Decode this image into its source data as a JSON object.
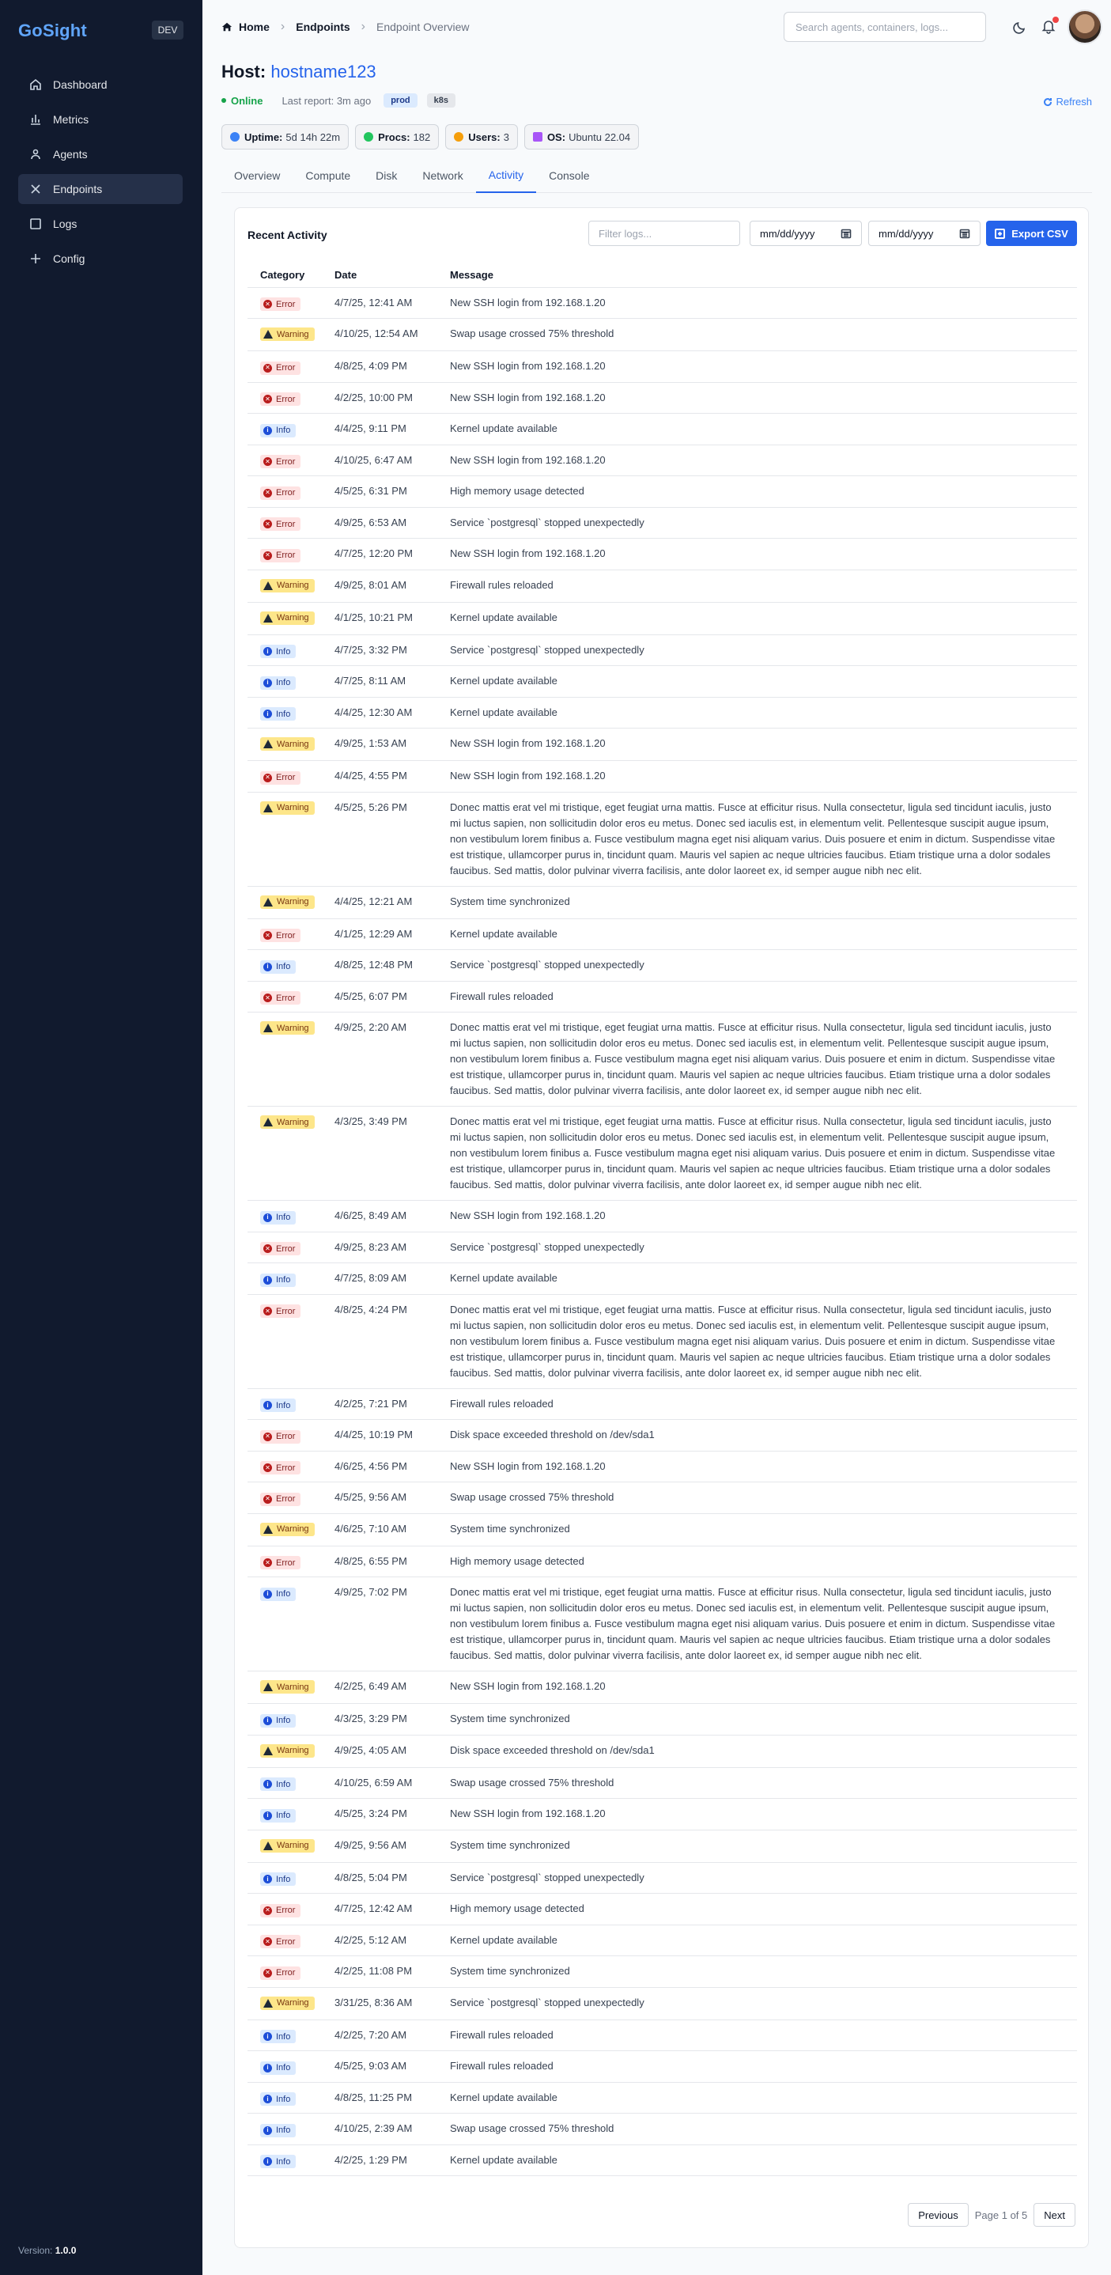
{
  "brand": {
    "name": "GoSight",
    "env": "DEV"
  },
  "sidebar": {
    "items": [
      {
        "label": "Dashboard",
        "icon": "home-icon",
        "active": false
      },
      {
        "label": "Metrics",
        "icon": "bar-chart-icon",
        "active": false
      },
      {
        "label": "Agents",
        "icon": "user-icon",
        "active": false
      },
      {
        "label": "Endpoints",
        "icon": "x-icon",
        "active": true
      },
      {
        "label": "Logs",
        "icon": "square-icon",
        "active": false
      },
      {
        "label": "Config",
        "icon": "plus-icon",
        "active": false
      }
    ],
    "version_label": "Version:",
    "version": "1.0.0"
  },
  "header": {
    "breadcrumb": [
      "Home",
      "Endpoints",
      "Endpoint Overview"
    ],
    "search_placeholder": "Search agents, containers, logs..."
  },
  "host": {
    "label": "Host:",
    "name": "hostname123",
    "status": "Online",
    "last_report": "Last report: 3m ago",
    "tags": [
      "prod",
      "k8s"
    ],
    "refresh": "Refresh"
  },
  "stats": [
    {
      "label": "Uptime:",
      "value": "5d 14h 22m",
      "color": "#3b82f6"
    },
    {
      "label": "Procs:",
      "value": "182",
      "color": "#22c55e"
    },
    {
      "label": "Users:",
      "value": "3",
      "color": "#f59e0b"
    },
    {
      "label": "OS:",
      "value": "Ubuntu 22.04",
      "color": "#a855f7"
    }
  ],
  "tabs": [
    "Overview",
    "Compute",
    "Disk",
    "Network",
    "Activity",
    "Console"
  ],
  "active_tab": "Activity",
  "activity": {
    "title": "Recent Activity",
    "filter_placeholder": "Filter logs...",
    "date_placeholder": "mm/dd/yyyy",
    "export_label": "Export CSV",
    "columns": [
      "Category",
      "Date",
      "Message"
    ],
    "rows": [
      {
        "cat": "Error",
        "date": "4/7/25, 12:41 AM",
        "msg": "New SSH login from 192.168.1.20"
      },
      {
        "cat": "Warning",
        "date": "4/10/25, 12:54 AM",
        "msg": "Swap usage crossed 75% threshold"
      },
      {
        "cat": "Error",
        "date": "4/8/25, 4:09 PM",
        "msg": "New SSH login from 192.168.1.20"
      },
      {
        "cat": "Error",
        "date": "4/2/25, 10:00 PM",
        "msg": "New SSH login from 192.168.1.20"
      },
      {
        "cat": "Info",
        "date": "4/4/25, 9:11 PM",
        "msg": "Kernel update available"
      },
      {
        "cat": "Error",
        "date": "4/10/25, 6:47 AM",
        "msg": "New SSH login from 192.168.1.20"
      },
      {
        "cat": "Error",
        "date": "4/5/25, 6:31 PM",
        "msg": "High memory usage detected"
      },
      {
        "cat": "Error",
        "date": "4/9/25, 6:53 AM",
        "msg": "Service `postgresql` stopped unexpectedly"
      },
      {
        "cat": "Error",
        "date": "4/7/25, 12:20 PM",
        "msg": "New SSH login from 192.168.1.20"
      },
      {
        "cat": "Warning",
        "date": "4/9/25, 8:01 AM",
        "msg": "Firewall rules reloaded"
      },
      {
        "cat": "Warning",
        "date": "4/1/25, 10:21 PM",
        "msg": "Kernel update available"
      },
      {
        "cat": "Info",
        "date": "4/7/25, 3:32 PM",
        "msg": "Service `postgresql` stopped unexpectedly"
      },
      {
        "cat": "Info",
        "date": "4/7/25, 8:11 AM",
        "msg": "Kernel update available"
      },
      {
        "cat": "Info",
        "date": "4/4/25, 12:30 AM",
        "msg": "Kernel update available"
      },
      {
        "cat": "Warning",
        "date": "4/9/25, 1:53 AM",
        "msg": "New SSH login from 192.168.1.20"
      },
      {
        "cat": "Error",
        "date": "4/4/25, 4:55 PM",
        "msg": "New SSH login from 192.168.1.20"
      },
      {
        "cat": "Warning",
        "date": "4/5/25, 5:26 PM",
        "msg": "Donec mattis erat vel mi tristique, eget feugiat urna mattis. Fusce at efficitur risus. Nulla consectetur, ligula sed tincidunt iaculis, justo mi luctus sapien, non sollicitudin dolor eros eu metus. Donec sed iaculis est, in elementum velit. Pellentesque suscipit augue ipsum, non vestibulum lorem finibus a. Fusce vestibulum magna eget nisi aliquam varius. Duis posuere et enim in dictum. Suspendisse vitae est tristique, ullamcorper purus in, tincidunt quam. Mauris vel sapien ac neque ultricies faucibus. Etiam tristique urna a dolor sodales faucibus. Sed mattis, dolor pulvinar viverra facilisis, ante dolor laoreet ex, id semper augue nibh nec elit."
      },
      {
        "cat": "Warning",
        "date": "4/4/25, 12:21 AM",
        "msg": "System time synchronized"
      },
      {
        "cat": "Error",
        "date": "4/1/25, 12:29 AM",
        "msg": "Kernel update available"
      },
      {
        "cat": "Info",
        "date": "4/8/25, 12:48 PM",
        "msg": "Service `postgresql` stopped unexpectedly"
      },
      {
        "cat": "Error",
        "date": "4/5/25, 6:07 PM",
        "msg": "Firewall rules reloaded"
      },
      {
        "cat": "Warning",
        "date": "4/9/25, 2:20 AM",
        "msg": "Donec mattis erat vel mi tristique, eget feugiat urna mattis. Fusce at efficitur risus. Nulla consectetur, ligula sed tincidunt iaculis, justo mi luctus sapien, non sollicitudin dolor eros eu metus. Donec sed iaculis est, in elementum velit. Pellentesque suscipit augue ipsum, non vestibulum lorem finibus a. Fusce vestibulum magna eget nisi aliquam varius. Duis posuere et enim in dictum. Suspendisse vitae est tristique, ullamcorper purus in, tincidunt quam. Mauris vel sapien ac neque ultricies faucibus. Etiam tristique urna a dolor sodales faucibus. Sed mattis, dolor pulvinar viverra facilisis, ante dolor laoreet ex, id semper augue nibh nec elit."
      },
      {
        "cat": "Warning",
        "date": "4/3/25, 3:49 PM",
        "msg": "Donec mattis erat vel mi tristique, eget feugiat urna mattis. Fusce at efficitur risus. Nulla consectetur, ligula sed tincidunt iaculis, justo mi luctus sapien, non sollicitudin dolor eros eu metus. Donec sed iaculis est, in elementum velit. Pellentesque suscipit augue ipsum, non vestibulum lorem finibus a. Fusce vestibulum magna eget nisi aliquam varius. Duis posuere et enim in dictum. Suspendisse vitae est tristique, ullamcorper purus in, tincidunt quam. Mauris vel sapien ac neque ultricies faucibus. Etiam tristique urna a dolor sodales faucibus. Sed mattis, dolor pulvinar viverra facilisis, ante dolor laoreet ex, id semper augue nibh nec elit."
      },
      {
        "cat": "Info",
        "date": "4/6/25, 8:49 AM",
        "msg": "New SSH login from 192.168.1.20"
      },
      {
        "cat": "Error",
        "date": "4/9/25, 8:23 AM",
        "msg": "Service `postgresql` stopped unexpectedly"
      },
      {
        "cat": "Info",
        "date": "4/7/25, 8:09 AM",
        "msg": "Kernel update available"
      },
      {
        "cat": "Error",
        "date": "4/8/25, 4:24 PM",
        "msg": "Donec mattis erat vel mi tristique, eget feugiat urna mattis. Fusce at efficitur risus. Nulla consectetur, ligula sed tincidunt iaculis, justo mi luctus sapien, non sollicitudin dolor eros eu metus. Donec sed iaculis est, in elementum velit. Pellentesque suscipit augue ipsum, non vestibulum lorem finibus a. Fusce vestibulum magna eget nisi aliquam varius. Duis posuere et enim in dictum. Suspendisse vitae est tristique, ullamcorper purus in, tincidunt quam. Mauris vel sapien ac neque ultricies faucibus. Etiam tristique urna a dolor sodales faucibus. Sed mattis, dolor pulvinar viverra facilisis, ante dolor laoreet ex, id semper augue nibh nec elit."
      },
      {
        "cat": "Info",
        "date": "4/2/25, 7:21 PM",
        "msg": "Firewall rules reloaded"
      },
      {
        "cat": "Error",
        "date": "4/4/25, 10:19 PM",
        "msg": "Disk space exceeded threshold on /dev/sda1"
      },
      {
        "cat": "Error",
        "date": "4/6/25, 4:56 PM",
        "msg": "New SSH login from 192.168.1.20"
      },
      {
        "cat": "Error",
        "date": "4/5/25, 9:56 AM",
        "msg": "Swap usage crossed 75% threshold"
      },
      {
        "cat": "Warning",
        "date": "4/6/25, 7:10 AM",
        "msg": "System time synchronized"
      },
      {
        "cat": "Error",
        "date": "4/8/25, 6:55 PM",
        "msg": "High memory usage detected"
      },
      {
        "cat": "Info",
        "date": "4/9/25, 7:02 PM",
        "msg": "Donec mattis erat vel mi tristique, eget feugiat urna mattis. Fusce at efficitur risus. Nulla consectetur, ligula sed tincidunt iaculis, justo mi luctus sapien, non sollicitudin dolor eros eu metus. Donec sed iaculis est, in elementum velit. Pellentesque suscipit augue ipsum, non vestibulum lorem finibus a. Fusce vestibulum magna eget nisi aliquam varius. Duis posuere et enim in dictum. Suspendisse vitae est tristique, ullamcorper purus in, tincidunt quam. Mauris vel sapien ac neque ultricies faucibus. Etiam tristique urna a dolor sodales faucibus. Sed mattis, dolor pulvinar viverra facilisis, ante dolor laoreet ex, id semper augue nibh nec elit."
      },
      {
        "cat": "Warning",
        "date": "4/2/25, 6:49 AM",
        "msg": "New SSH login from 192.168.1.20"
      },
      {
        "cat": "Info",
        "date": "4/3/25, 3:29 PM",
        "msg": "System time synchronized"
      },
      {
        "cat": "Warning",
        "date": "4/9/25, 4:05 AM",
        "msg": "Disk space exceeded threshold on /dev/sda1"
      },
      {
        "cat": "Info",
        "date": "4/10/25, 6:59 AM",
        "msg": "Swap usage crossed 75% threshold"
      },
      {
        "cat": "Info",
        "date": "4/5/25, 3:24 PM",
        "msg": "New SSH login from 192.168.1.20"
      },
      {
        "cat": "Warning",
        "date": "4/9/25, 9:56 AM",
        "msg": "System time synchronized"
      },
      {
        "cat": "Info",
        "date": "4/8/25, 5:04 PM",
        "msg": "Service `postgresql` stopped unexpectedly"
      },
      {
        "cat": "Error",
        "date": "4/7/25, 12:42 AM",
        "msg": "High memory usage detected"
      },
      {
        "cat": "Error",
        "date": "4/2/25, 5:12 AM",
        "msg": "Kernel update available"
      },
      {
        "cat": "Error",
        "date": "4/2/25, 11:08 PM",
        "msg": "System time synchronized"
      },
      {
        "cat": "Warning",
        "date": "3/31/25, 8:36 AM",
        "msg": "Service `postgresql` stopped unexpectedly"
      },
      {
        "cat": "Info",
        "date": "4/2/25, 7:20 AM",
        "msg": "Firewall rules reloaded"
      },
      {
        "cat": "Info",
        "date": "4/5/25, 9:03 AM",
        "msg": "Firewall rules reloaded"
      },
      {
        "cat": "Info",
        "date": "4/8/25, 11:25 PM",
        "msg": "Kernel update available"
      },
      {
        "cat": "Info",
        "date": "4/10/25, 2:39 AM",
        "msg": "Swap usage crossed 75% threshold"
      },
      {
        "cat": "Info",
        "date": "4/2/25, 1:29 PM",
        "msg": "Kernel update available"
      }
    ],
    "pager": {
      "prev": "Previous",
      "info": "Page 1 of 5",
      "next": "Next"
    }
  }
}
